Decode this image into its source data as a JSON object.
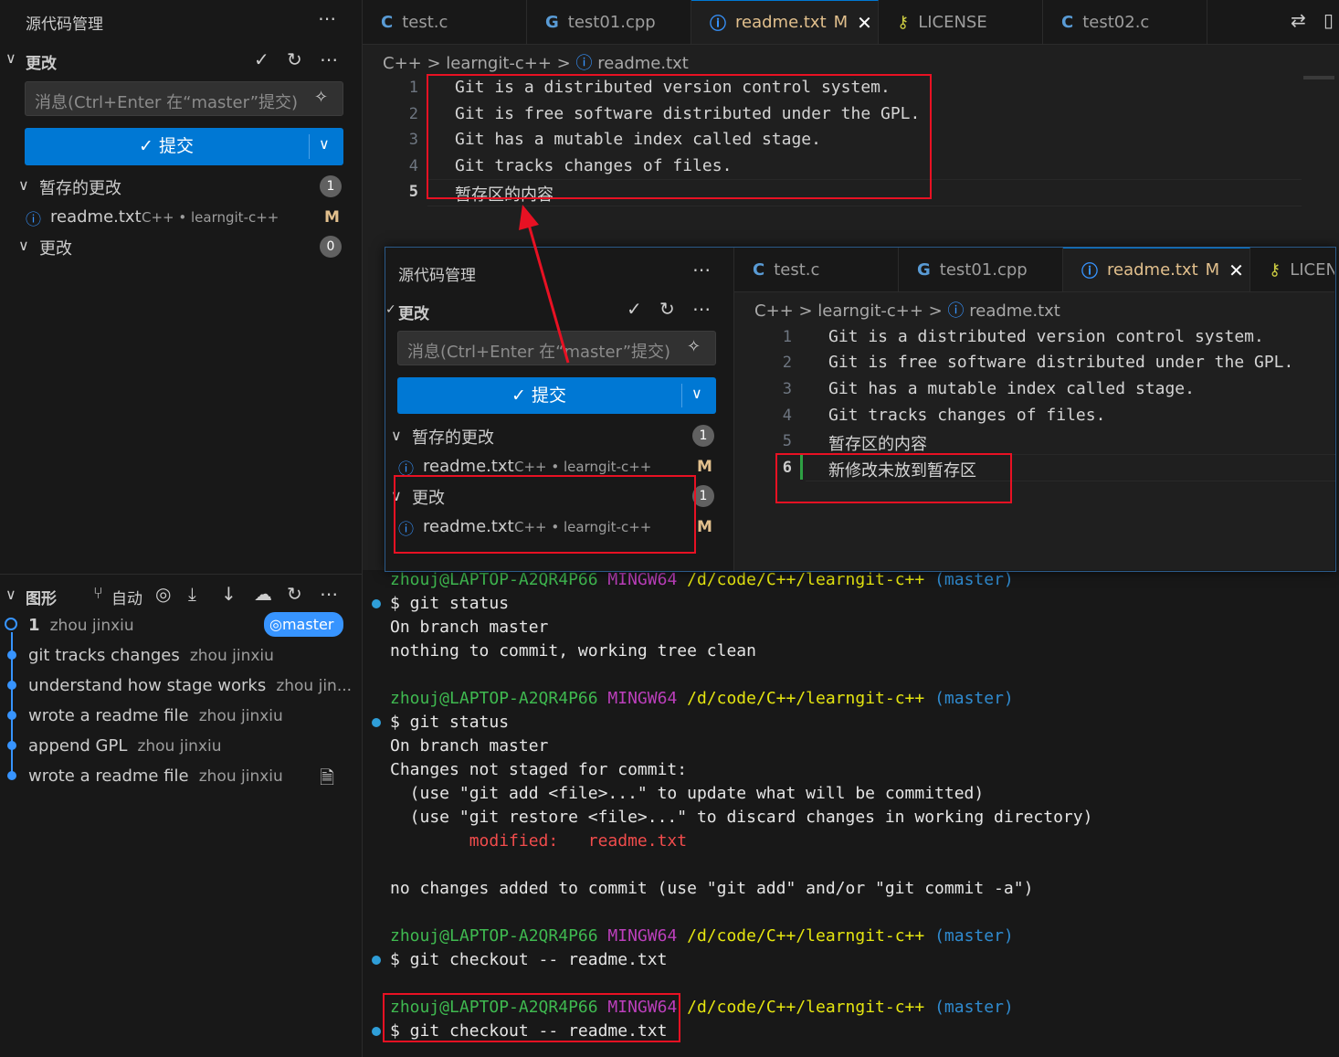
{
  "scm": {
    "title": "源代码管理",
    "section": "更改",
    "message_placeholder": "消息(Ctrl+Enter 在“master”提交)",
    "commit_label": "提交",
    "staged_header": "暂存的更改",
    "staged_count": "1",
    "changes_header": "更改",
    "changes_count": "0",
    "file_name": "readme.txt",
    "file_desc": "C++ • learngit-c++",
    "file_status": "M"
  },
  "graph": {
    "title": "图形",
    "auto_label": "自动",
    "commits": [
      {
        "msg": "1",
        "author": "zhou jinxiu"
      },
      {
        "msg": "git tracks changes",
        "author": "zhou jinxiu"
      },
      {
        "msg": "understand how stage works",
        "author": "zhou jin..."
      },
      {
        "msg": "wrote a readme file",
        "author": "zhou jinxiu"
      },
      {
        "msg": "append GPL",
        "author": "zhou jinxiu"
      },
      {
        "msg": "wrote a readme file",
        "author": "zhou jinxiu"
      }
    ],
    "branch": "master"
  },
  "tabs": [
    {
      "label": "test.c",
      "icon": "C"
    },
    {
      "label": "test01.cpp",
      "icon": "G"
    },
    {
      "label": "readme.txt",
      "status": "M",
      "icon": "i"
    },
    {
      "label": "LICENSE",
      "icon": "key"
    },
    {
      "label": "test02.c",
      "icon": "C"
    }
  ],
  "breadcrumb": {
    "root": "C++",
    "folder": "learngit-c++",
    "file": "readme.txt",
    "sep": ">"
  },
  "editor_lines": [
    "Git is a distributed version control system.",
    "Git is free software distributed under the GPL.",
    "Git has a mutable index called stage.",
    "Git tracks changes of files.",
    "暂存区的内容",
    "新修改未放到暂存区"
  ],
  "overlay": {
    "staged_count": "1",
    "changes_count": "1",
    "tab_license": "LICEN"
  },
  "terminal": {
    "prompt_user": "zhouj@LAPTOP-A2QR4P66",
    "prompt_sys": "MINGW64",
    "prompt_path": "/d/code/C++/learngit-c++",
    "prompt_branch": "(master)",
    "cmd_status": "$ git status",
    "on_branch": "On branch master",
    "clean": "nothing to commit, working tree clean",
    "not_staged": "Changes not staged for commit:",
    "hint1": "  (use \"git add <file>...\" to update what will be committed)",
    "hint2": "  (use \"git restore <file>...\" to discard changes in working directory)",
    "modified": "        modified:   readme.txt",
    "no_changes": "no changes added to commit (use \"git add\" and/or \"git commit -a\")",
    "cmd_checkout": "$ git checkout -- readme.txt"
  }
}
